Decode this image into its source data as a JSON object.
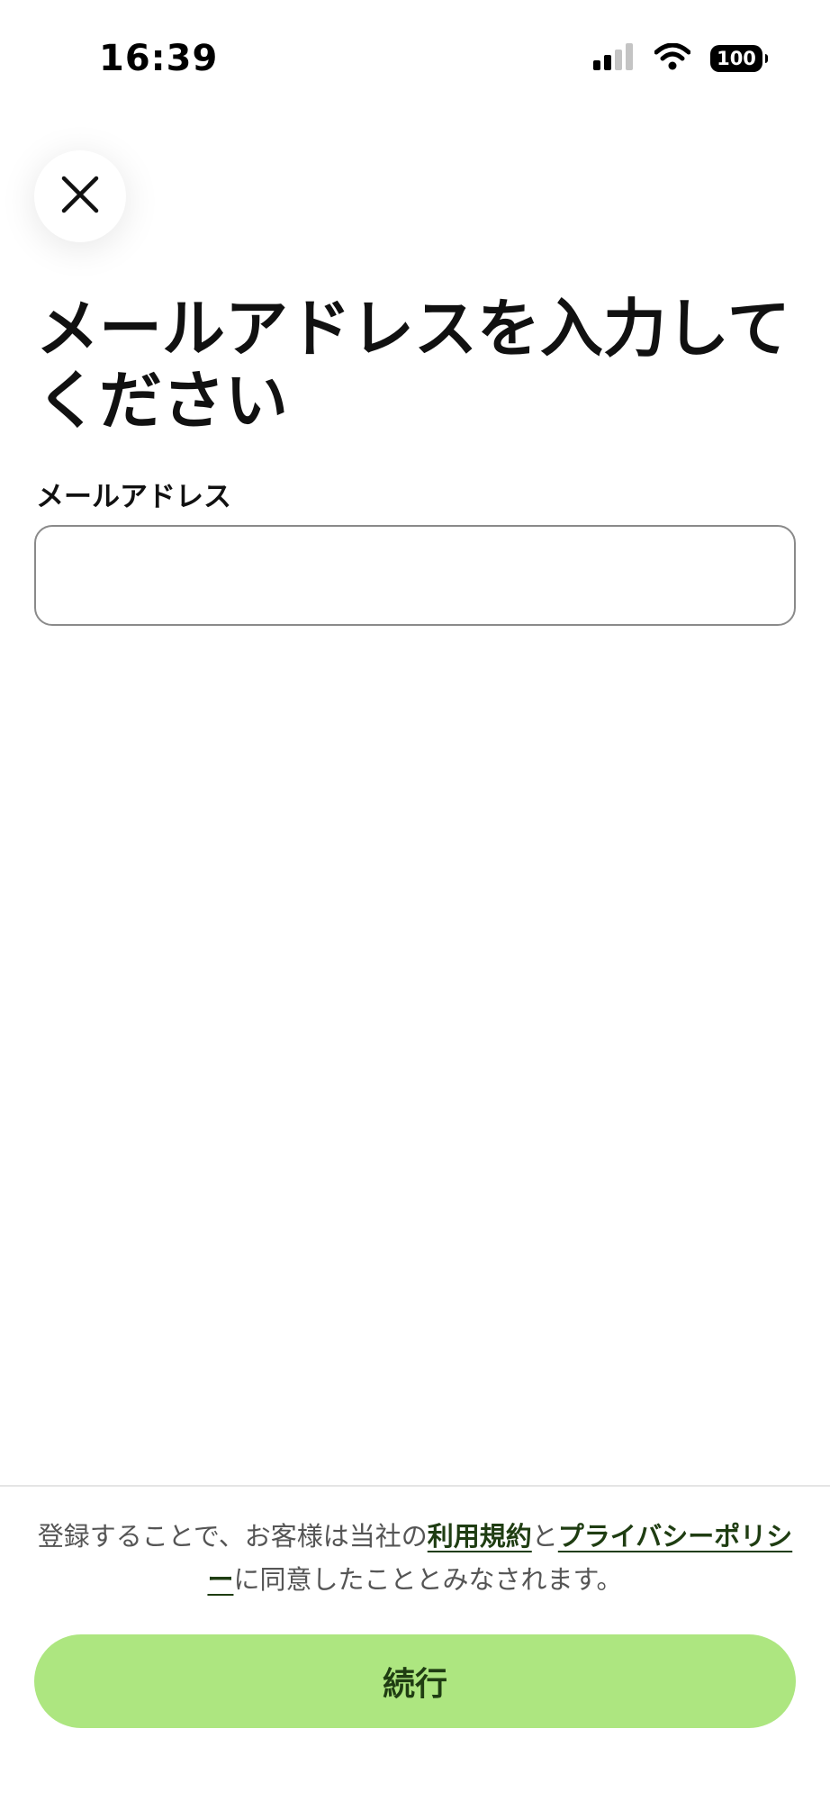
{
  "status_bar": {
    "time": "16:39",
    "battery_level": "100",
    "icons": [
      "cellular-signal-icon",
      "wifi-icon",
      "battery-icon"
    ]
  },
  "header": {
    "close_icon": "close-icon"
  },
  "title": "メールアドレスを入力してください",
  "email": {
    "label": "メールアドレス",
    "value": "",
    "placeholder": ""
  },
  "terms": {
    "before": "登録することで、お客様は当社の",
    "terms_link": "利用規約",
    "middle": "と",
    "privacy_link": "プライバシーポリシー",
    "after": "に同意したこととみなされます。"
  },
  "continue_button": {
    "label": "続行"
  },
  "colors": {
    "accent_green": "#ade680",
    "link_text": "#1f3d12",
    "body_text": "#555555"
  }
}
